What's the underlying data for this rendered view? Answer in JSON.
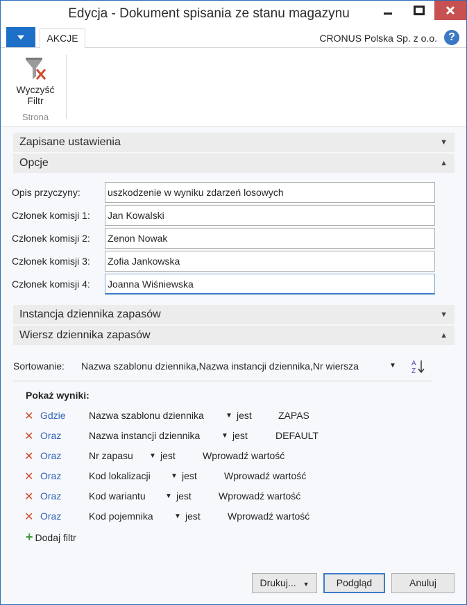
{
  "window": {
    "title": "Edycja - Dokument spisania ze stanu magazynu"
  },
  "ribbon": {
    "tab": "AKCJE",
    "company": "CRONUS Polska Sp. z o.o.",
    "help": "?",
    "clear_filter_line1": "Wyczyść",
    "clear_filter_line2": "Filtr",
    "group": "Strona"
  },
  "sections": {
    "saved": "Zapisane ustawienia",
    "options": "Opcje",
    "journal_instance": "Instancja dziennika zapasów",
    "journal_line": "Wiersz dziennika zapasów"
  },
  "options": [
    {
      "label": "Opis przyczyny:",
      "value": "uszkodzenie w wyniku zdarzeń losowych"
    },
    {
      "label": "Członek komisji 1:",
      "value": "Jan Kowalski"
    },
    {
      "label": "Członek komisji 2:",
      "value": "Zenon Nowak"
    },
    {
      "label": "Członek komisji 3:",
      "value": "Zofia Jankowska"
    },
    {
      "label": "Członek komisji 4:",
      "value": "Joanna Wiśniewska"
    }
  ],
  "sorting": {
    "label": "Sortowanie:",
    "value": "Nazwa szablonu dziennika,Nazwa instancji dziennika,Nr wiersza"
  },
  "filters": {
    "title": "Pokaż wyniki:",
    "rows": [
      {
        "conj": "Gdzie",
        "field": "Nazwa szablonu dziennika",
        "op": "jest",
        "value": "ZAPAS"
      },
      {
        "conj": "Oraz",
        "field": "Nazwa instancji dziennika",
        "op": "jest",
        "value": "DEFAULT"
      },
      {
        "conj": "Oraz",
        "field": "Nr zapasu",
        "op": "jest",
        "value": "Wprowadź wartość"
      },
      {
        "conj": "Oraz",
        "field": "Kod lokalizacji",
        "op": "jest",
        "value": "Wprowadź wartość"
      },
      {
        "conj": "Oraz",
        "field": "Kod wariantu",
        "op": "jest",
        "value": "Wprowadź wartość"
      },
      {
        "conj": "Oraz",
        "field": "Kod pojemnika",
        "op": "jest",
        "value": "Wprowadź wartość"
      }
    ],
    "add": "Dodaj filtr"
  },
  "buttons": {
    "print": "Drukuj...",
    "preview": "Podgląd",
    "cancel": "Anuluj"
  }
}
